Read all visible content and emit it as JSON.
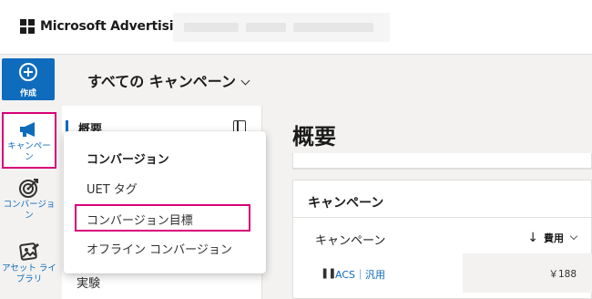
{
  "app": {
    "brand": "Microsoft Advertising"
  },
  "header": {
    "title": "すべての キャンペーン"
  },
  "leftnav": {
    "create_label": "作成",
    "items": [
      {
        "label": "キャンペーン",
        "icon": "megaphone-icon",
        "selected": true
      },
      {
        "label": "コンバージョン",
        "icon": "target-icon",
        "selected": false
      },
      {
        "label": "アセット ライブラリ",
        "icon": "asset-library-icon",
        "selected": false
      }
    ]
  },
  "subnav": {
    "overview": "概要",
    "experiment": "実験"
  },
  "dropdown": {
    "title": "コンバージョン",
    "items": [
      "UET タグ",
      "コンバージョン目標",
      "オフライン コンバージョン"
    ],
    "highlighted_index": 1
  },
  "main": {
    "title": "概要",
    "campaign_card": {
      "title": "キャンペーン",
      "column_header": "キャンペーン",
      "sort_column": "費用",
      "row": {
        "name": "ACS｜汎用",
        "value": "￥188",
        "status": "paused"
      }
    }
  },
  "colors": {
    "accent": "#0f6cbd",
    "highlight": "#d6007a"
  }
}
